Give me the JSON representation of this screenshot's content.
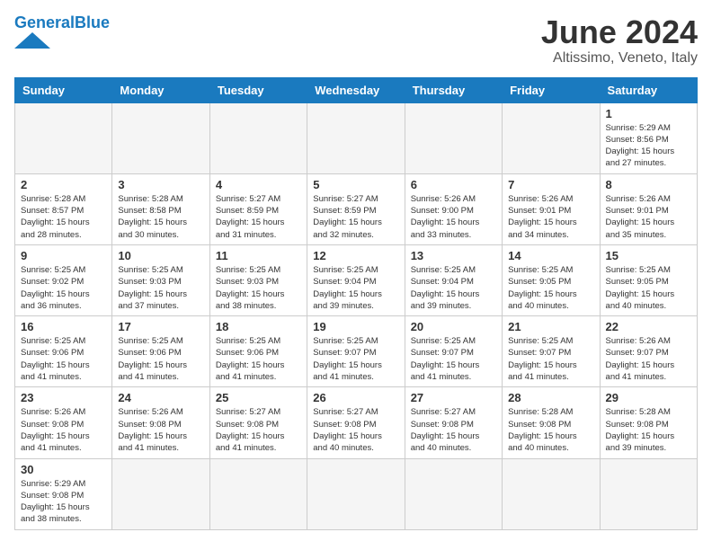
{
  "header": {
    "logo_general": "General",
    "logo_blue": "Blue",
    "month_title": "June 2024",
    "location": "Altissimo, Veneto, Italy"
  },
  "weekdays": [
    "Sunday",
    "Monday",
    "Tuesday",
    "Wednesday",
    "Thursday",
    "Friday",
    "Saturday"
  ],
  "weeks": [
    [
      {
        "day": "",
        "info": ""
      },
      {
        "day": "",
        "info": ""
      },
      {
        "day": "",
        "info": ""
      },
      {
        "day": "",
        "info": ""
      },
      {
        "day": "",
        "info": ""
      },
      {
        "day": "",
        "info": ""
      },
      {
        "day": "1",
        "info": "Sunrise: 5:29 AM\nSunset: 8:56 PM\nDaylight: 15 hours\nand 27 minutes."
      }
    ],
    [
      {
        "day": "2",
        "info": "Sunrise: 5:28 AM\nSunset: 8:57 PM\nDaylight: 15 hours\nand 28 minutes."
      },
      {
        "day": "3",
        "info": "Sunrise: 5:28 AM\nSunset: 8:58 PM\nDaylight: 15 hours\nand 30 minutes."
      },
      {
        "day": "4",
        "info": "Sunrise: 5:27 AM\nSunset: 8:59 PM\nDaylight: 15 hours\nand 31 minutes."
      },
      {
        "day": "5",
        "info": "Sunrise: 5:27 AM\nSunset: 8:59 PM\nDaylight: 15 hours\nand 32 minutes."
      },
      {
        "day": "6",
        "info": "Sunrise: 5:26 AM\nSunset: 9:00 PM\nDaylight: 15 hours\nand 33 minutes."
      },
      {
        "day": "7",
        "info": "Sunrise: 5:26 AM\nSunset: 9:01 PM\nDaylight: 15 hours\nand 34 minutes."
      },
      {
        "day": "8",
        "info": "Sunrise: 5:26 AM\nSunset: 9:01 PM\nDaylight: 15 hours\nand 35 minutes."
      }
    ],
    [
      {
        "day": "9",
        "info": "Sunrise: 5:25 AM\nSunset: 9:02 PM\nDaylight: 15 hours\nand 36 minutes."
      },
      {
        "day": "10",
        "info": "Sunrise: 5:25 AM\nSunset: 9:03 PM\nDaylight: 15 hours\nand 37 minutes."
      },
      {
        "day": "11",
        "info": "Sunrise: 5:25 AM\nSunset: 9:03 PM\nDaylight: 15 hours\nand 38 minutes."
      },
      {
        "day": "12",
        "info": "Sunrise: 5:25 AM\nSunset: 9:04 PM\nDaylight: 15 hours\nand 39 minutes."
      },
      {
        "day": "13",
        "info": "Sunrise: 5:25 AM\nSunset: 9:04 PM\nDaylight: 15 hours\nand 39 minutes."
      },
      {
        "day": "14",
        "info": "Sunrise: 5:25 AM\nSunset: 9:05 PM\nDaylight: 15 hours\nand 40 minutes."
      },
      {
        "day": "15",
        "info": "Sunrise: 5:25 AM\nSunset: 9:05 PM\nDaylight: 15 hours\nand 40 minutes."
      }
    ],
    [
      {
        "day": "16",
        "info": "Sunrise: 5:25 AM\nSunset: 9:06 PM\nDaylight: 15 hours\nand 41 minutes."
      },
      {
        "day": "17",
        "info": "Sunrise: 5:25 AM\nSunset: 9:06 PM\nDaylight: 15 hours\nand 41 minutes."
      },
      {
        "day": "18",
        "info": "Sunrise: 5:25 AM\nSunset: 9:06 PM\nDaylight: 15 hours\nand 41 minutes."
      },
      {
        "day": "19",
        "info": "Sunrise: 5:25 AM\nSunset: 9:07 PM\nDaylight: 15 hours\nand 41 minutes."
      },
      {
        "day": "20",
        "info": "Sunrise: 5:25 AM\nSunset: 9:07 PM\nDaylight: 15 hours\nand 41 minutes."
      },
      {
        "day": "21",
        "info": "Sunrise: 5:25 AM\nSunset: 9:07 PM\nDaylight: 15 hours\nand 41 minutes."
      },
      {
        "day": "22",
        "info": "Sunrise: 5:26 AM\nSunset: 9:07 PM\nDaylight: 15 hours\nand 41 minutes."
      }
    ],
    [
      {
        "day": "23",
        "info": "Sunrise: 5:26 AM\nSunset: 9:08 PM\nDaylight: 15 hours\nand 41 minutes."
      },
      {
        "day": "24",
        "info": "Sunrise: 5:26 AM\nSunset: 9:08 PM\nDaylight: 15 hours\nand 41 minutes."
      },
      {
        "day": "25",
        "info": "Sunrise: 5:27 AM\nSunset: 9:08 PM\nDaylight: 15 hours\nand 41 minutes."
      },
      {
        "day": "26",
        "info": "Sunrise: 5:27 AM\nSunset: 9:08 PM\nDaylight: 15 hours\nand 40 minutes."
      },
      {
        "day": "27",
        "info": "Sunrise: 5:27 AM\nSunset: 9:08 PM\nDaylight: 15 hours\nand 40 minutes."
      },
      {
        "day": "28",
        "info": "Sunrise: 5:28 AM\nSunset: 9:08 PM\nDaylight: 15 hours\nand 40 minutes."
      },
      {
        "day": "29",
        "info": "Sunrise: 5:28 AM\nSunset: 9:08 PM\nDaylight: 15 hours\nand 39 minutes."
      }
    ],
    [
      {
        "day": "30",
        "info": "Sunrise: 5:29 AM\nSunset: 9:08 PM\nDaylight: 15 hours\nand 38 minutes."
      },
      {
        "day": "",
        "info": ""
      },
      {
        "day": "",
        "info": ""
      },
      {
        "day": "",
        "info": ""
      },
      {
        "day": "",
        "info": ""
      },
      {
        "day": "",
        "info": ""
      },
      {
        "day": "",
        "info": ""
      }
    ]
  ]
}
